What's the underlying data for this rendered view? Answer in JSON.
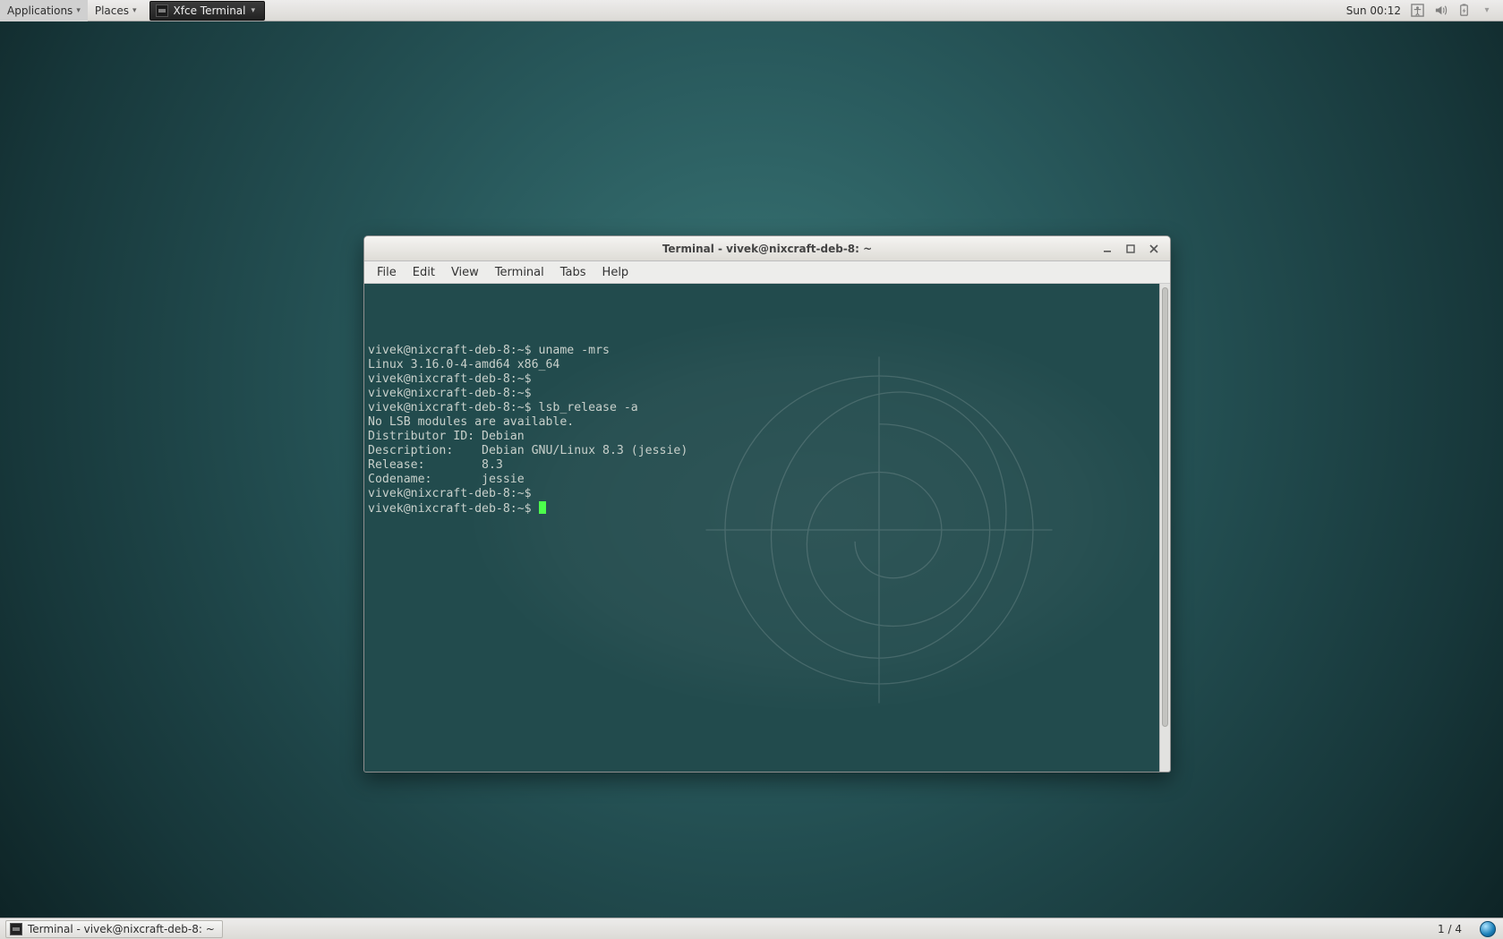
{
  "top_panel": {
    "applications": "Applications",
    "places": "Places",
    "active_app": "Xfce Terminal",
    "clock": "Sun 00:12"
  },
  "window": {
    "title": "Terminal - vivek@nixcraft-deb-8: ~",
    "menubar": {
      "file": "File",
      "edit": "Edit",
      "view": "View",
      "terminal": "Terminal",
      "tabs": "Tabs",
      "help": "Help"
    },
    "terminal": {
      "lines": [
        "vivek@nixcraft-deb-8:~$ uname -mrs",
        "Linux 3.16.0-4-amd64 x86_64",
        "vivek@nixcraft-deb-8:~$ ",
        "vivek@nixcraft-deb-8:~$ ",
        "vivek@nixcraft-deb-8:~$ lsb_release -a",
        "No LSB modules are available.",
        "Distributor ID: Debian",
        "Description:    Debian GNU/Linux 8.3 (jessie)",
        "Release:        8.3",
        "Codename:       jessie",
        "vivek@nixcraft-deb-8:~$ ",
        "vivek@nixcraft-deb-8:~$ "
      ]
    }
  },
  "bottom_panel": {
    "task_label": "Terminal - vivek@nixcraft-deb-8: ~",
    "workspace": "1 / 4"
  }
}
